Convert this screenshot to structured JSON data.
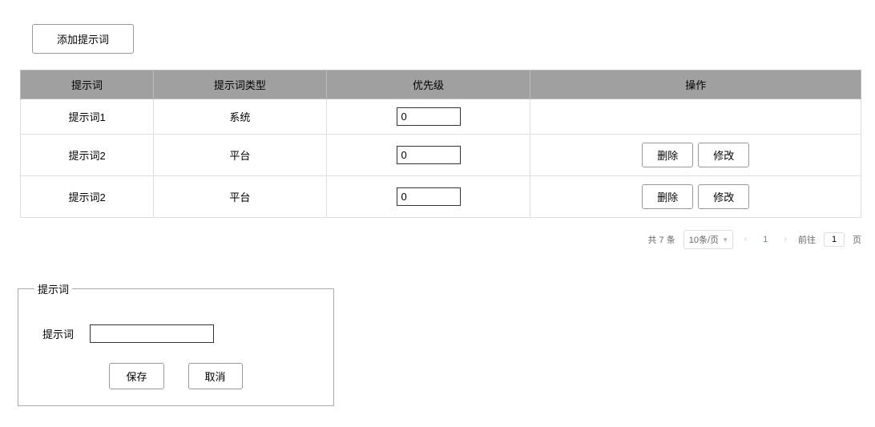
{
  "addButton": "添加提示词",
  "table": {
    "headers": [
      "提示词",
      "提示词类型",
      "优先级",
      "操作"
    ],
    "rows": [
      {
        "name": "提示词1",
        "type": "系统",
        "priority": "0",
        "actions": false
      },
      {
        "name": "提示词2",
        "type": "平台",
        "priority": "0",
        "actions": true
      },
      {
        "name": "提示词2",
        "type": "平台",
        "priority": "0",
        "actions": true
      }
    ],
    "deleteLabel": "删除",
    "editLabel": "修改"
  },
  "pagination": {
    "total": "共 7 条",
    "pageSize": "10条/页",
    "current": "1",
    "gotoLabel": "前往",
    "gotoValue": "1",
    "pageSuffix": "页"
  },
  "form": {
    "legend": "提示词",
    "label": "提示词",
    "value": "",
    "save": "保存",
    "cancel": "取消"
  }
}
